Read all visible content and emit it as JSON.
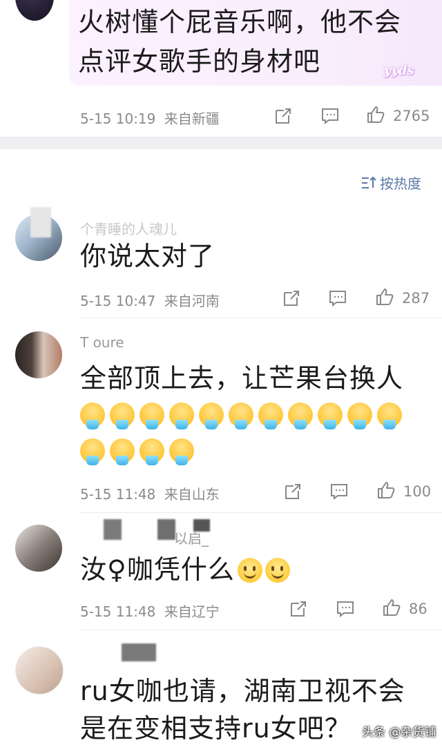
{
  "top_comment": {
    "text": "火树懂个屁音乐啊，他不会点评女歌手的身材吧",
    "badge": "yyds",
    "time": "5-15 10:19",
    "location": "来自新疆",
    "likes": "2765"
  },
  "sort": {
    "label": "按热度"
  },
  "comments": [
    {
      "username": "个青睡的人魂儿",
      "text": "你说太对了",
      "time": "5-15 10:47",
      "location": "来自河南",
      "likes": "287"
    },
    {
      "username": "T      oure",
      "text": "全部顶上去，让芒果台换人",
      "emoji_count": 15,
      "time": "5-15 11:48",
      "location": "来自山东",
      "likes": "100"
    },
    {
      "username": "以启_",
      "text": "汝♀咖凭什么",
      "time": "5-15 11:48",
      "location": "来自辽宁",
      "likes": "86"
    },
    {
      "username": "",
      "text": "ru女咖也请，湖南卫视不会是在变相支持ru女吧？"
    }
  ],
  "watermark": "头条 @杂货铺",
  "colors": {
    "meta": "#8a8a8a",
    "sort_blue": "#5b79a8",
    "separator": "#efeff1"
  }
}
